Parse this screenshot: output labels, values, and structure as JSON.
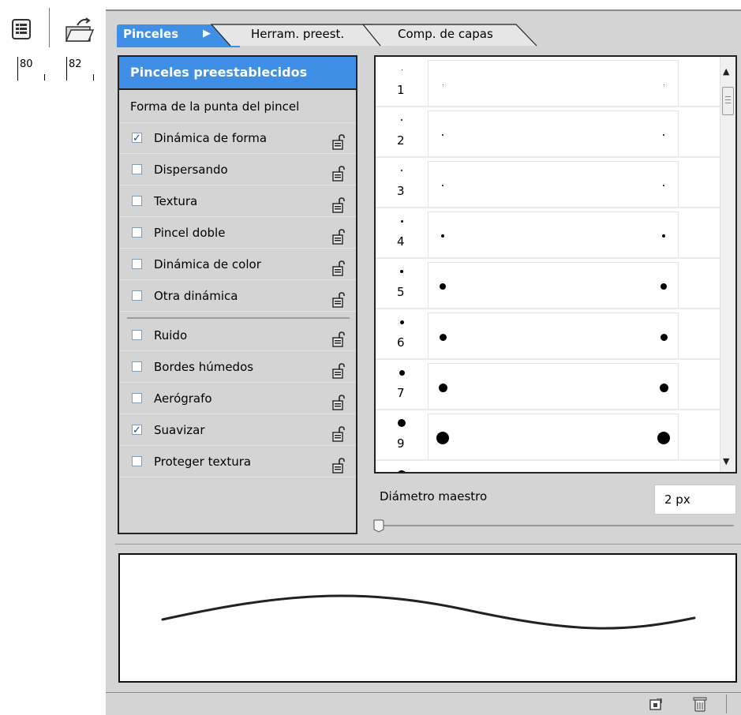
{
  "ruler": {
    "labels": [
      "80",
      "82"
    ]
  },
  "tabs": [
    {
      "label": "Pinceles",
      "active": true
    },
    {
      "label": "Herram. preest.",
      "active": false
    },
    {
      "label": "Comp. de capas",
      "active": false
    }
  ],
  "settings": {
    "header": "Pinceles preestablecidos",
    "shape_label": "Forma de la punta del pincel",
    "items": [
      {
        "label": "Dinámica de forma",
        "checked": true
      },
      {
        "label": "Dispersando",
        "checked": false
      },
      {
        "label": "Textura",
        "checked": false
      },
      {
        "label": "Pincel doble",
        "checked": false
      },
      {
        "label": "Dinámica de color",
        "checked": false
      },
      {
        "label": "Otra dinámica",
        "checked": false
      },
      {
        "label": "Ruido",
        "checked": false
      },
      {
        "label": "Bordes húmedos",
        "checked": false
      },
      {
        "label": "Aerógrafo",
        "checked": false
      },
      {
        "label": "Suavizar",
        "checked": true
      },
      {
        "label": "Proteger textura",
        "checked": false
      }
    ]
  },
  "brushes": [
    {
      "size": "1"
    },
    {
      "size": "2"
    },
    {
      "size": "3"
    },
    {
      "size": "4"
    },
    {
      "size": "5"
    },
    {
      "size": "6"
    },
    {
      "size": "7"
    },
    {
      "size": "9"
    }
  ],
  "diameter": {
    "label": "Diámetro maestro",
    "value": "2 px"
  },
  "colors": {
    "accent": "#3f8fe6",
    "panel": "#d4d4d4"
  },
  "icons": [
    "document-icon",
    "folder-open-icon",
    "lock-icon",
    "new-brush-icon",
    "trash-icon",
    "arrow-right-icon"
  ]
}
